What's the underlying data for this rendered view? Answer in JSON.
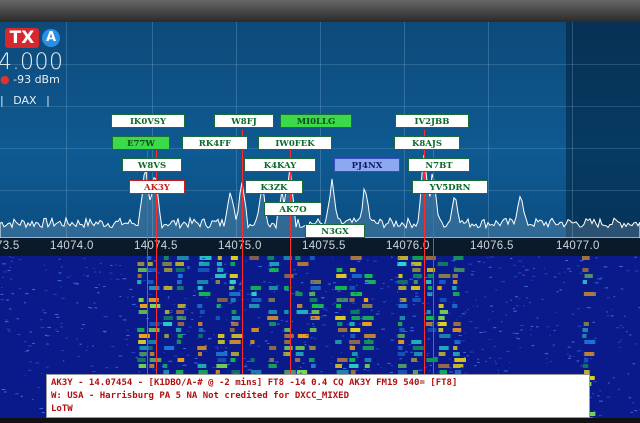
{
  "radio": {
    "tx_label": "TX",
    "antenna_label": "A",
    "frequency": "4.000",
    "signal_dbm": "-93 dBm",
    "mode_divider": "|",
    "dax_label": "DAX"
  },
  "scale": {
    "labels": [
      "73.5",
      "14074.0",
      "14074.5",
      "14075.0",
      "14075.5",
      "14076.0",
      "14076.5",
      "14077.0"
    ]
  },
  "spots": [
    {
      "call": "IK0VSY",
      "style": "white"
    },
    {
      "call": "W8FJ",
      "style": "white"
    },
    {
      "call": "MI0LLG",
      "style": "green"
    },
    {
      "call": "IV2JBB",
      "style": "white"
    },
    {
      "call": "E77W",
      "style": "green"
    },
    {
      "call": "RK4FF",
      "style": "white"
    },
    {
      "call": "IW0FEK",
      "style": "white"
    },
    {
      "call": "K8AJS",
      "style": "white"
    },
    {
      "call": "W8VS",
      "style": "white"
    },
    {
      "call": "K4KAY",
      "style": "white"
    },
    {
      "call": "PJ4NX",
      "style": "blue"
    },
    {
      "call": "N7BT",
      "style": "white"
    },
    {
      "call": "AK3Y",
      "style": "red"
    },
    {
      "call": "K3ZK",
      "style": "white"
    },
    {
      "call": "YV5DRN",
      "style": "white"
    },
    {
      "call": "AK7O",
      "style": "white"
    },
    {
      "call": "N3GX",
      "style": "white"
    }
  ],
  "info_box": {
    "line1": "AK3Y - 14.07454 - [K1DBO/A-# @ -2 mins] FT8 -14  0.4 CQ AK3Y FM19 540= [FT8]",
    "line2": "W: USA - Harrisburg PA 5 NA Not credited for DXCC_MIXED",
    "line3": "LoTW"
  },
  "colors": {
    "spectrum_bg": "#0e5a92",
    "waterfall_bg": "#0a1a8a",
    "tx_red": "#d9272e",
    "spot_green": "#3cd94a",
    "spot_blue": "#8da8f0",
    "info_text": "#b01010"
  }
}
